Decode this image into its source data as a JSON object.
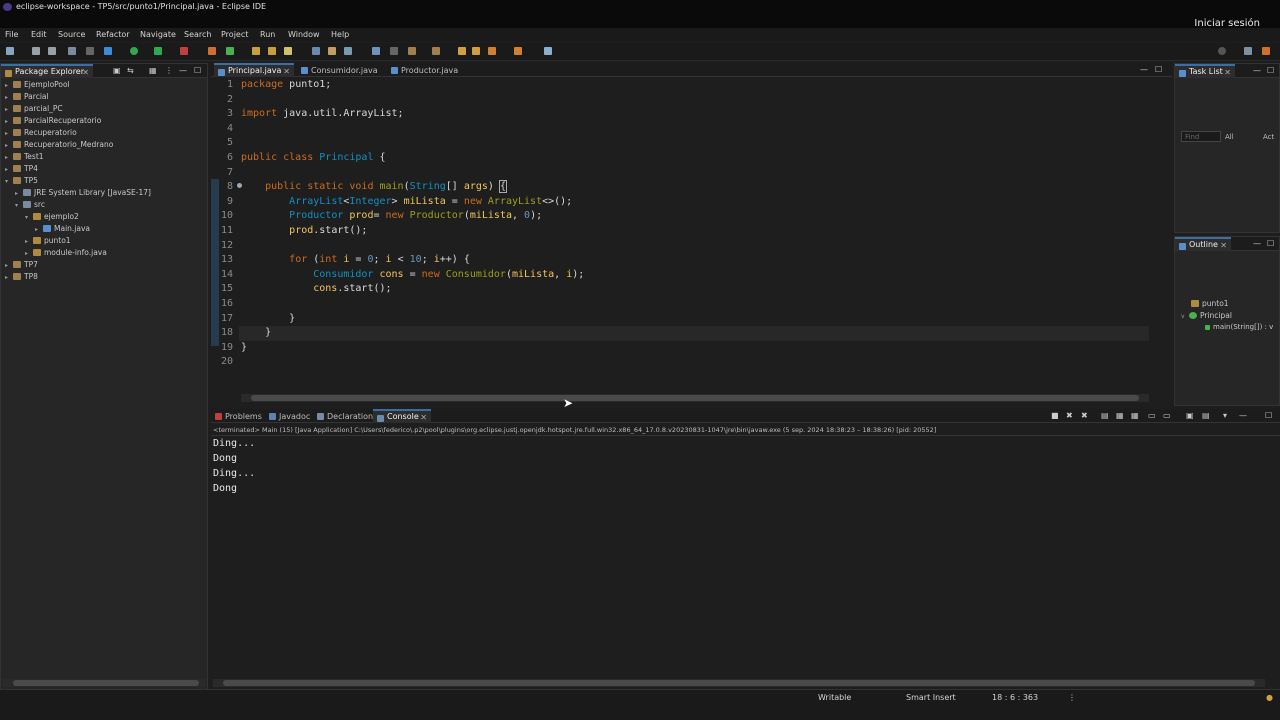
{
  "window": {
    "title": "eclipse-workspace - TP5/src/punto1/Principal.java - Eclipse IDE",
    "signin": "Iniciar sesión"
  },
  "menu": [
    "File",
    "Edit",
    "Source",
    "Refactor",
    "Navigate",
    "Search",
    "Project",
    "Run",
    "Window",
    "Help"
  ],
  "package_explorer": {
    "tab": "Package Explorer",
    "items": [
      {
        "label": "EjemploPool",
        "depth": 0,
        "arrow": ">"
      },
      {
        "label": "Parcial",
        "depth": 0,
        "arrow": ">"
      },
      {
        "label": "parcial_PC",
        "depth": 0,
        "arrow": ">"
      },
      {
        "label": "ParcialRecuperatorio",
        "depth": 0,
        "arrow": ">"
      },
      {
        "label": "Recuperatorio",
        "depth": 0,
        "arrow": ">"
      },
      {
        "label": "Recuperatorio_Medrano",
        "depth": 0,
        "arrow": ">"
      },
      {
        "label": "Test1",
        "depth": 0,
        "arrow": ">"
      },
      {
        "label": "TP4",
        "depth": 0,
        "arrow": ">"
      },
      {
        "label": "TP5",
        "depth": 0,
        "arrow": "v"
      },
      {
        "label": "JRE System Library [JavaSE-17]",
        "depth": 1,
        "arrow": ">"
      },
      {
        "label": "src",
        "depth": 1,
        "arrow": "v"
      },
      {
        "label": "ejemplo2",
        "depth": 2,
        "arrow": "v"
      },
      {
        "label": "Main.java",
        "depth": 3,
        "arrow": ">"
      },
      {
        "label": "punto1",
        "depth": 2,
        "arrow": ">"
      },
      {
        "label": "module-info.java",
        "depth": 2,
        "arrow": ">"
      },
      {
        "label": "TP7",
        "depth": 0,
        "arrow": ">"
      },
      {
        "label": "TP8",
        "depth": 0,
        "arrow": ">"
      }
    ]
  },
  "editor": {
    "tabs": [
      "Principal.java",
      "Consumidor.java",
      "Productor.java"
    ],
    "line_numbers": [
      "1",
      "2",
      "3",
      "4",
      "5",
      "6",
      "7",
      "8",
      "9",
      "10",
      "11",
      "12",
      "13",
      "14",
      "15",
      "16",
      "17",
      "18",
      "19",
      "20"
    ]
  },
  "task_list": {
    "tab": "Task List",
    "find_placeholder": "Find",
    "all_label": "All",
    "act_label": "Act"
  },
  "outline": {
    "tab": "Outline",
    "items": [
      "punto1",
      "Principal",
      "main(String[]) : v"
    ]
  },
  "bottom": {
    "tabs": [
      "Problems",
      "Javadoc",
      "Declaration",
      "Console"
    ],
    "terminated": "<terminated> Main (15) [Java Application] C:\\Users\\federico\\.p2\\pool\\plugins\\org.eclipse.justj.openjdk.hotspot.jre.full.win32.x86_64_17.0.8.v20230831-1047\\jre\\bin\\javaw.exe (5 sep. 2024 18:38:23 – 18:38:26) [pid: 20552]",
    "output": [
      "Ding...",
      "Dong",
      "Ding...",
      "Dong"
    ]
  },
  "status": {
    "writable": "Writable",
    "insert": "Smart Insert",
    "position": "18 : 6 : 363"
  },
  "colors": {
    "keyword": "#cc6c1d",
    "type": "#1290c3",
    "accent": "#3a6ea5"
  }
}
